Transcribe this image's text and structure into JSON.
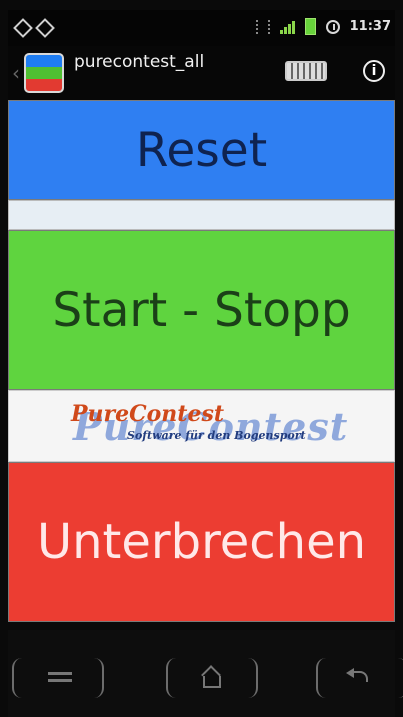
{
  "status_bar": {
    "time": "11:37",
    "icons": [
      "usb-icon",
      "usb-icon",
      "wifi-icon",
      "signal-icon",
      "battery-icon",
      "alarm-icon"
    ]
  },
  "title_bar": {
    "app_name": "purecontest_all",
    "icons": [
      "app-icon",
      "keyboard-icon",
      "info-icon"
    ]
  },
  "main": {
    "reset_label": "Reset",
    "start_stop_label": "Start - Stopp",
    "interrupt_label": "Unterbrechen"
  },
  "brand": {
    "name": "PureContest",
    "background_name": "PureContest",
    "subtitle": "Software für den Bogensport"
  },
  "softkeys": {
    "icons": [
      "menu-icon",
      "home-icon",
      "back-icon"
    ]
  },
  "colors": {
    "reset": "#2f7ff2",
    "start": "#5fd43f",
    "interrupt": "#ec3d32"
  }
}
